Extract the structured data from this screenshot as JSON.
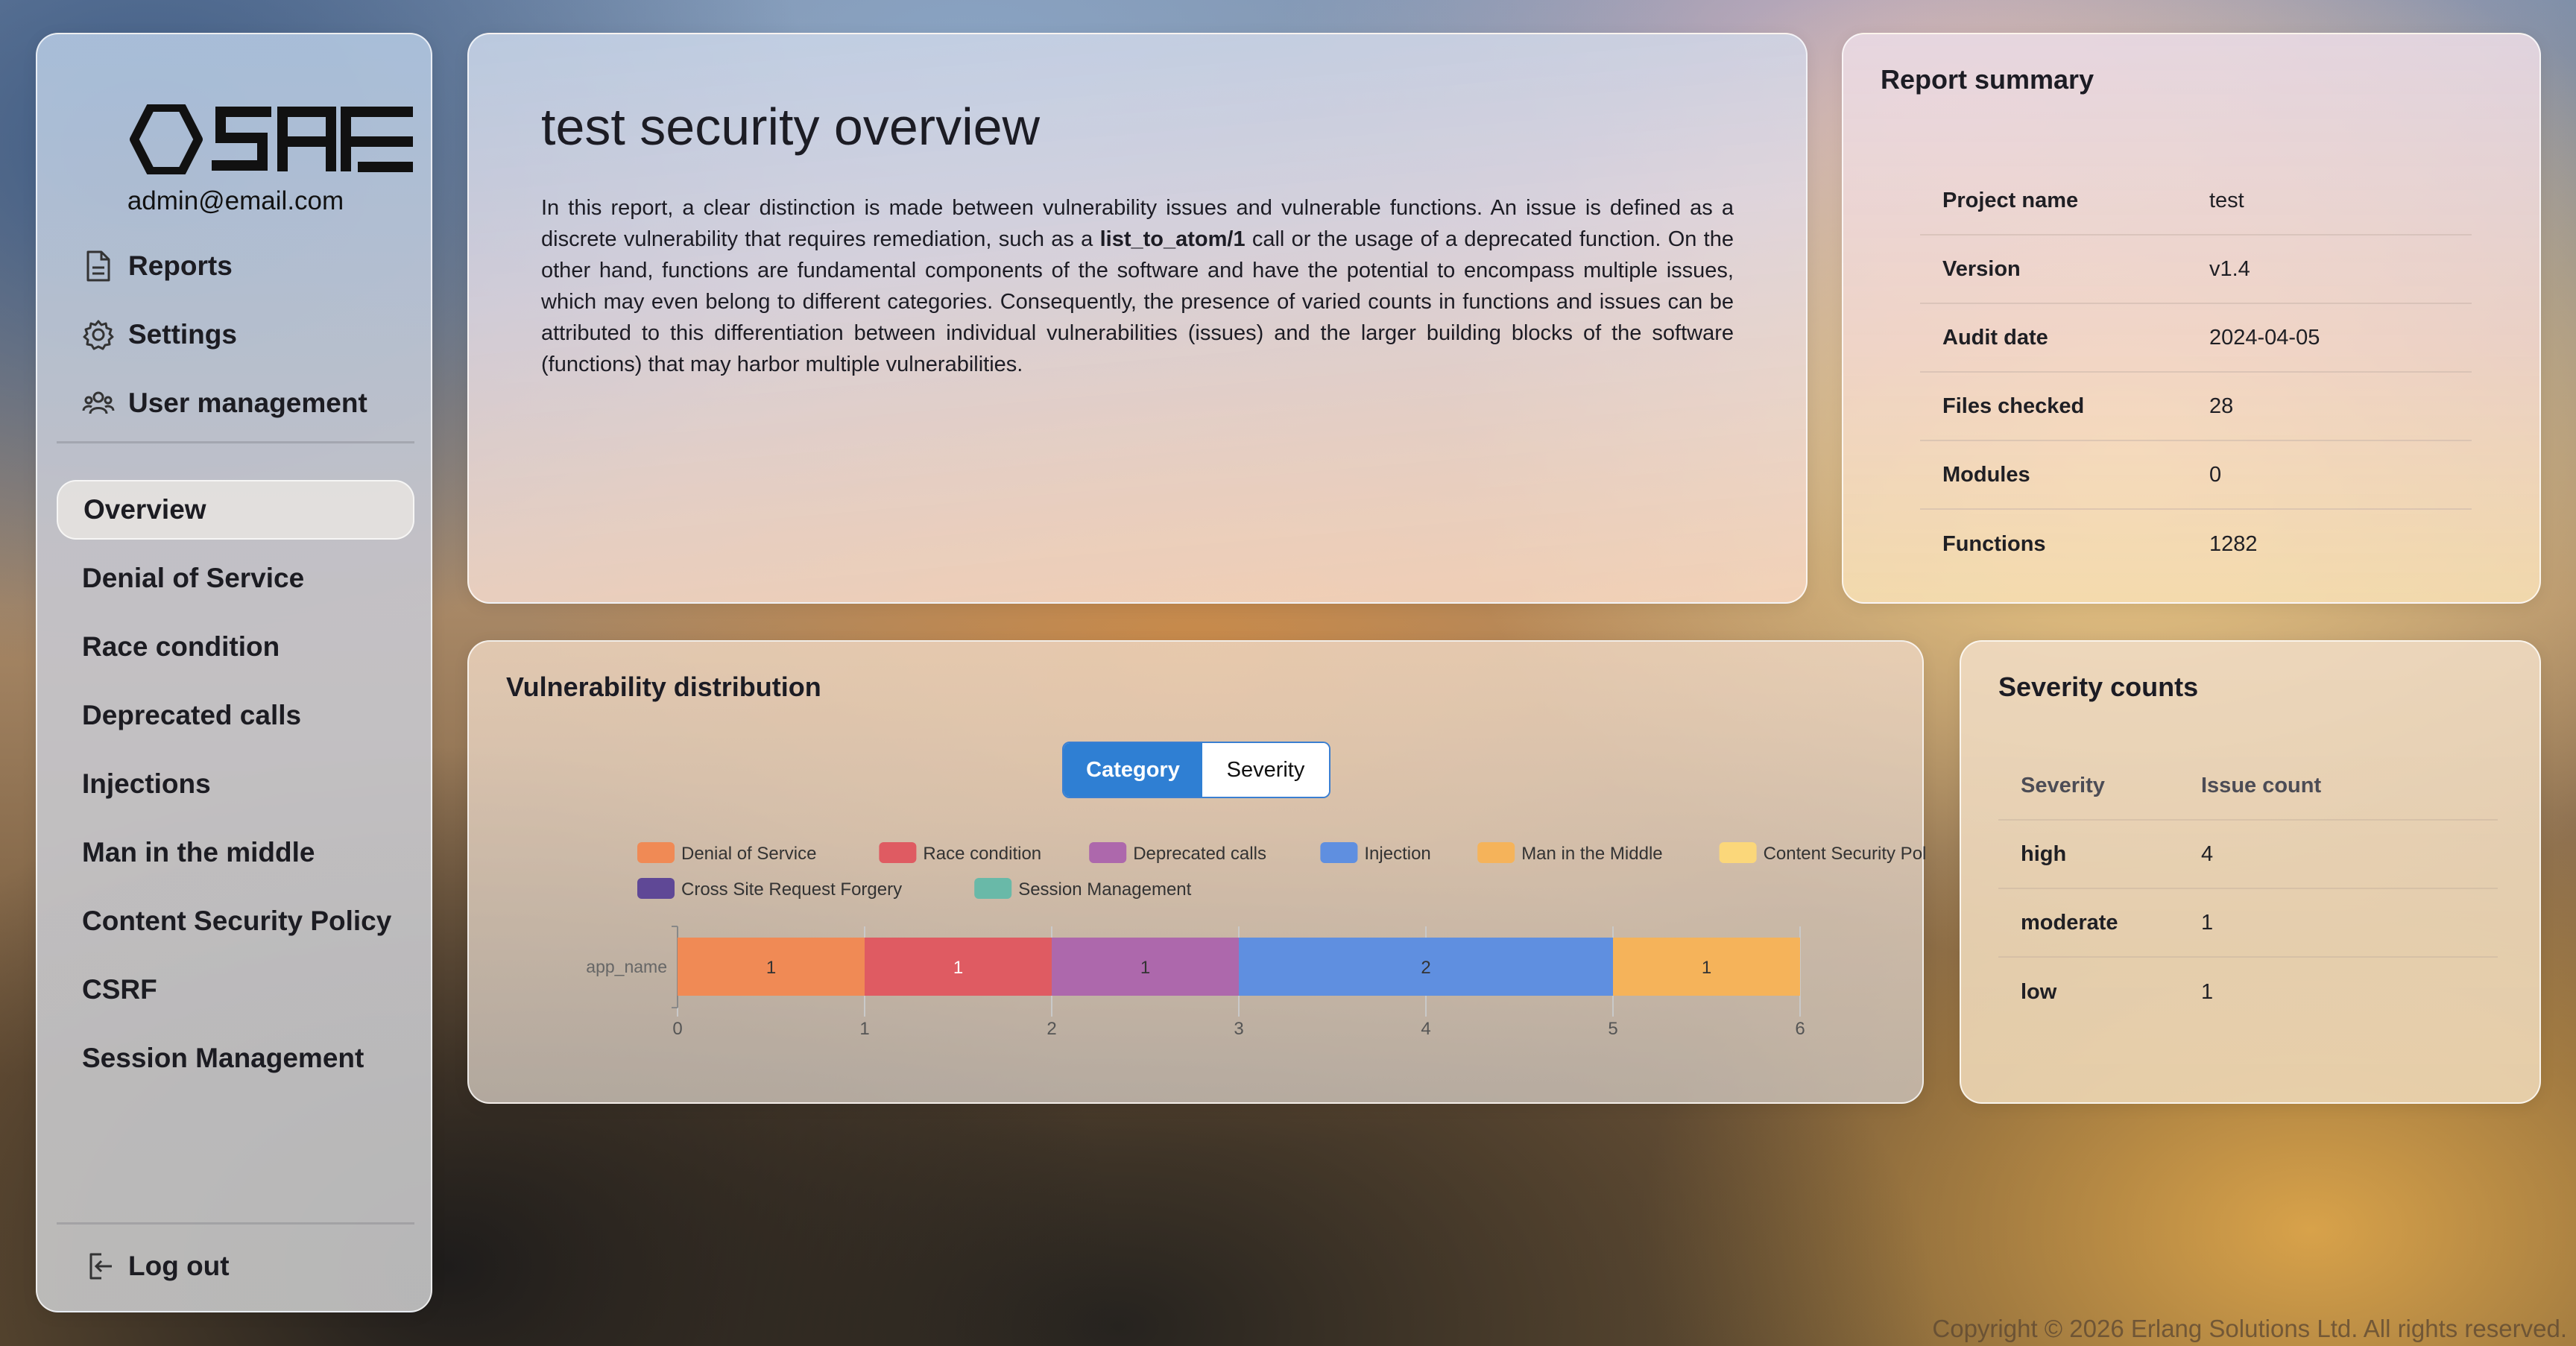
{
  "sidebar": {
    "email": "admin@email.com",
    "nav": [
      {
        "label": "Reports",
        "icon": "document-icon"
      },
      {
        "label": "Settings",
        "icon": "gear-icon"
      },
      {
        "label": "User management",
        "icon": "users-icon"
      }
    ],
    "categories": [
      "Overview",
      "Denial of Service",
      "Race condition",
      "Deprecated calls",
      "Injections",
      "Man in the middle",
      "Content Security Policy",
      "CSRF",
      "Session Management"
    ],
    "active_category": "Overview",
    "logout": "Log out"
  },
  "overview": {
    "title": "test security overview",
    "text_part1": "In this report, a clear distinction is made between vulnerability issues and vulnerable functions. An issue is defined as a discrete vulnerability that requires remediation, such as a ",
    "text_bold": "list_to_atom/1",
    "text_part2": " call or the usage of a deprecated function. On the other hand, functions are fundamental components of the software and have the potential to encompass multiple issues, which may even belong to different categories. Consequently, the presence of varied counts in functions and issues can be attributed to this differentiation between individual vulnerabilities (issues) and the larger building blocks of the software (functions) that may harbor multiple vulnerabilities."
  },
  "summary": {
    "title": "Report summary",
    "rows": [
      {
        "key": "Project name",
        "value": "test"
      },
      {
        "key": "Version",
        "value": "v1.4"
      },
      {
        "key": "Audit date",
        "value": "2024-04-05"
      },
      {
        "key": "Files checked",
        "value": "28"
      },
      {
        "key": "Modules",
        "value": "0"
      },
      {
        "key": "Functions",
        "value": "1282"
      }
    ]
  },
  "distribution": {
    "title": "Vulnerability distribution",
    "toggle": {
      "category": "Category",
      "severity": "Severity",
      "selected": "Category"
    }
  },
  "chart_data": {
    "type": "bar",
    "orientation": "horizontal-stacked",
    "categories": [
      "app_name"
    ],
    "series": [
      {
        "name": "Denial of Service",
        "values": [
          1
        ],
        "color": "#f08a55"
      },
      {
        "name": "Race condition",
        "values": [
          1
        ],
        "color": "#df5b62"
      },
      {
        "name": "Deprecated calls",
        "values": [
          1
        ],
        "color": "#ad68ac"
      },
      {
        "name": "Injection",
        "values": [
          2
        ],
        "color": "#5f8fe0"
      },
      {
        "name": "Man in the Middle",
        "values": [
          1
        ],
        "color": "#f5b35a"
      },
      {
        "name": "Content Security Policy",
        "values": [
          0
        ],
        "color": "#fbd77a"
      },
      {
        "name": "Cross Site Request Forgery",
        "values": [
          0
        ],
        "color": "#5f4896"
      },
      {
        "name": "Session Management",
        "values": [
          0
        ],
        "color": "#69b9a8"
      }
    ],
    "xlim": [
      0,
      6
    ],
    "xticks": [
      0,
      1,
      2,
      3,
      4,
      5,
      6
    ],
    "legend": "top"
  },
  "severity": {
    "title": "Severity counts",
    "headers": [
      "Severity",
      "Issue count"
    ],
    "rows": [
      {
        "level": "high",
        "count": "4"
      },
      {
        "level": "moderate",
        "count": "1"
      },
      {
        "level": "low",
        "count": "1"
      }
    ]
  },
  "footer": "Copyright © 2026 Erlang Solutions Ltd. All rights reserved."
}
